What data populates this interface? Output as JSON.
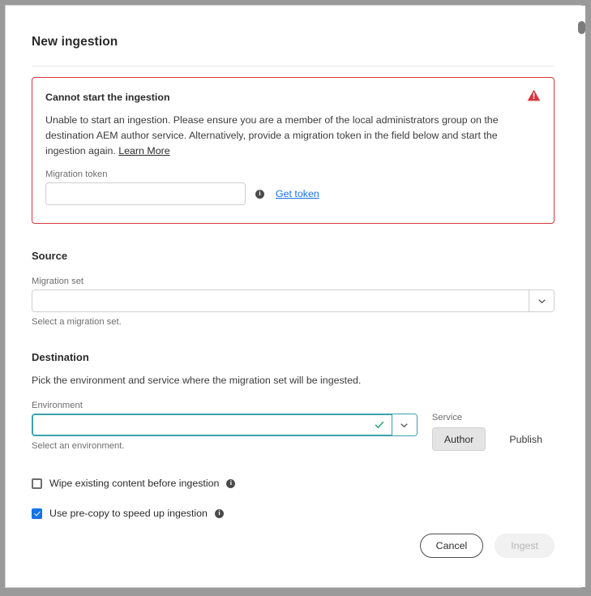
{
  "dialog": {
    "title": "New ingestion"
  },
  "error": {
    "heading": "Cannot start the ingestion",
    "body": "Unable to start an ingestion. Please ensure you are a member of the local administrators group on the destination AEM author service. Alternatively, provide a migration token in the field below and start the ingestion again. ",
    "learn_more": "Learn More",
    "alert_icon": "alert-triangle-icon",
    "border_color": "#d7373f",
    "token_label": "Migration token",
    "token_value": "",
    "token_placeholder": "",
    "info_icon": "info-icon",
    "get_token_link": "Get token",
    "link_color": "#1473e6"
  },
  "source": {
    "heading": "Source",
    "migration_set_label": "Migration set",
    "migration_set_value": "",
    "migration_set_placeholder": "",
    "help_text": "Select a migration set.",
    "chevron_icon": "chevron-down-icon"
  },
  "destination": {
    "heading": "Destination",
    "description": "Pick the environment and service where the migration set will be ingested.",
    "environment_label": "Environment",
    "environment_value": "",
    "environment_placeholder": "",
    "help_text": "Select an environment.",
    "valid_icon": "checkmark-icon",
    "valid_color": "#2d9d78",
    "chevron_icon": "chevron-down-icon",
    "service_label": "Service",
    "services": [
      {
        "label": "Author",
        "selected": true
      },
      {
        "label": "Publish",
        "selected": false
      }
    ]
  },
  "options": [
    {
      "label": "Wipe existing content before ingestion",
      "checked": false,
      "info_icon": "info-icon"
    },
    {
      "label": "Use pre-copy to speed up ingestion",
      "checked": true,
      "info_icon": "info-icon"
    }
  ],
  "footer": {
    "cancel_label": "Cancel",
    "ingest_label": "Ingest"
  },
  "scrollbar": {
    "name": "vertical-scrollbar"
  }
}
